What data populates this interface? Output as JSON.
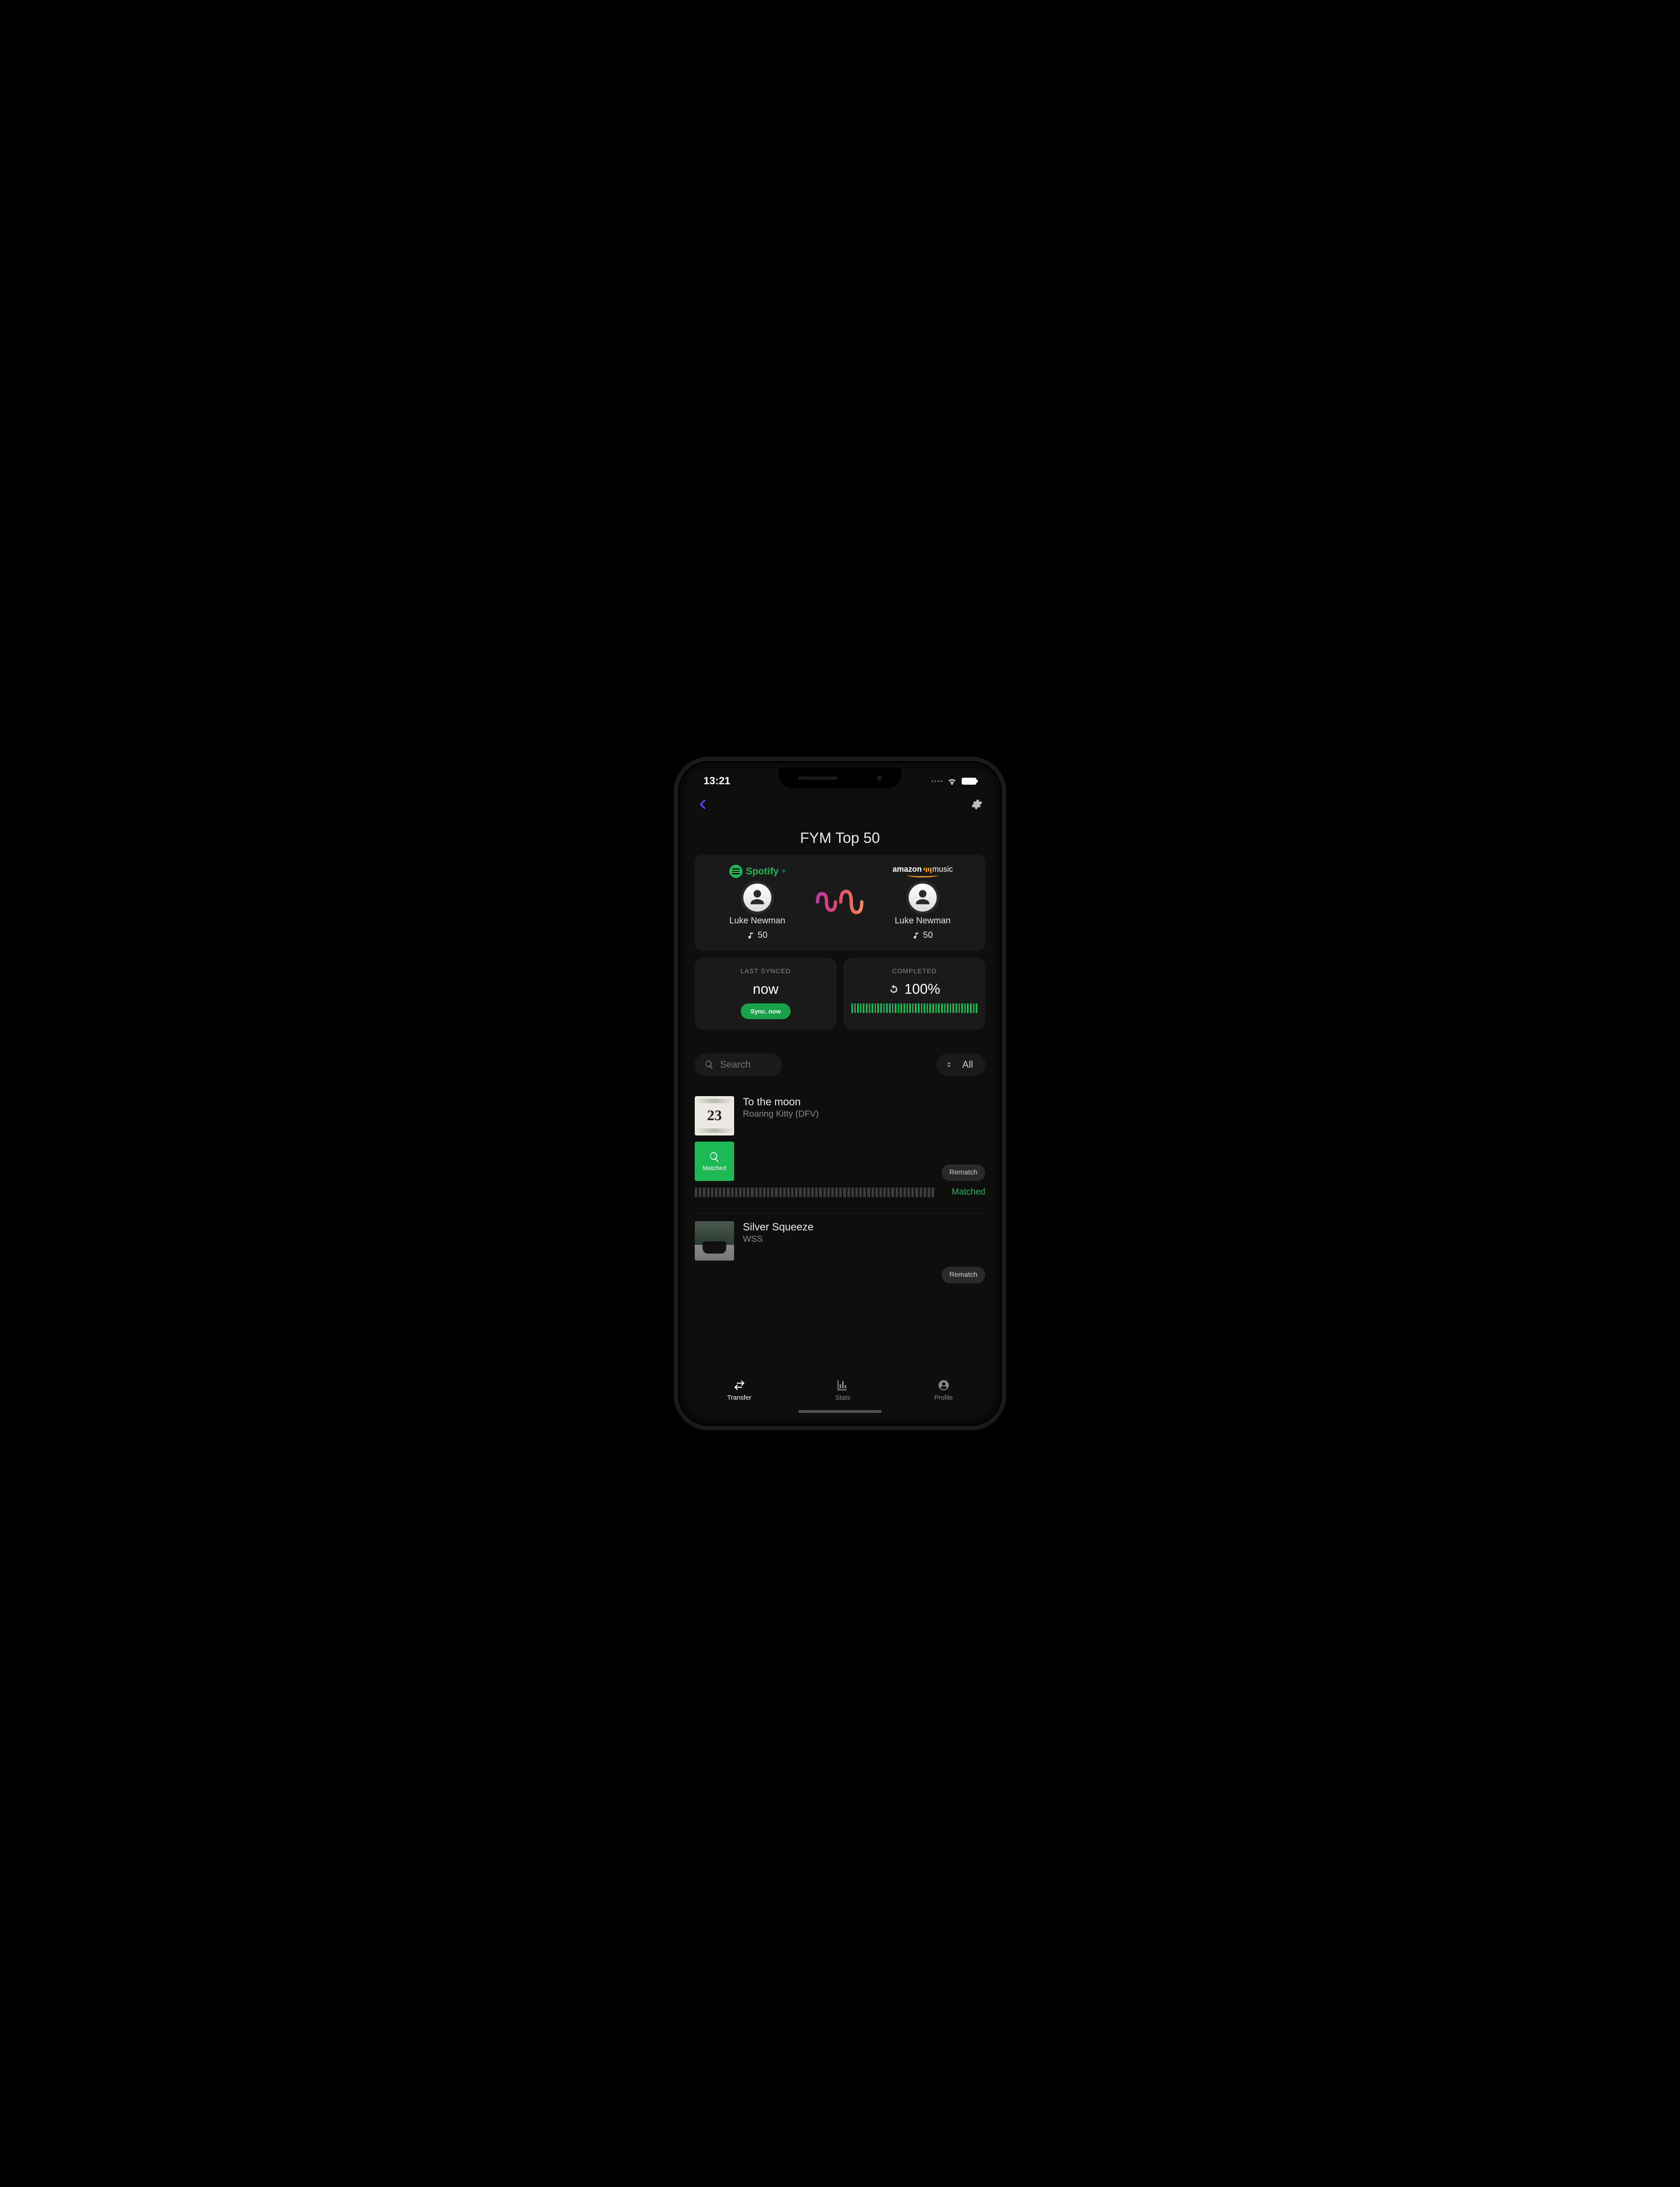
{
  "status": {
    "time": "13:21"
  },
  "header": {
    "title": "FYM Top 50"
  },
  "services": {
    "source": {
      "provider": "Spotify",
      "user": "Luke Newman",
      "tracks": "50"
    },
    "target": {
      "provider_line1": "amazon",
      "provider_line2": "music",
      "user": "Luke Newman",
      "tracks": "50"
    }
  },
  "sync": {
    "last_synced_label": "LAST SYNCED",
    "last_synced_value": "now",
    "sync_button": "Sync. now",
    "completed_label": "COMPLETED",
    "completed_value": "100%"
  },
  "search": {
    "placeholder": "Search"
  },
  "filter": {
    "value": "All"
  },
  "tracks": [
    {
      "title": "To the moon",
      "artist": "Roaring Kitty (DFV)",
      "cover_text": "23",
      "rematch": "Rematch",
      "matched_tile": "Matched",
      "status": "Matched"
    },
    {
      "title": "Silver Squeeze",
      "artist": "WSS",
      "rematch": "Rematch"
    }
  ],
  "tabs": {
    "transfer": "Transfer",
    "stats": "Stats",
    "profile": "Profile"
  }
}
